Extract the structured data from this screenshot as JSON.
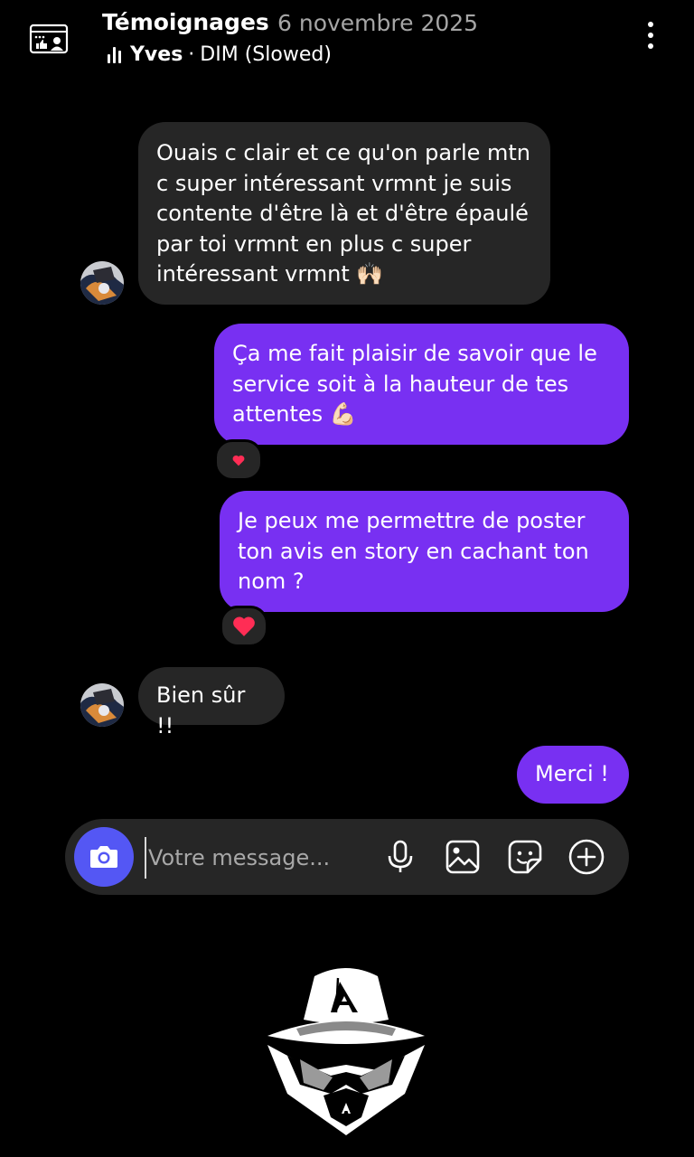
{
  "header": {
    "title": "Témoignages",
    "date": "6 novembre 2025",
    "music_artist": "Yves",
    "music_separator": "·",
    "music_track": "DIM (Slowed)",
    "icons": [
      "reviews-icon",
      "music-bars-icon",
      "more-options-icon"
    ]
  },
  "messages": [
    {
      "from": "them",
      "text": "Ouais c clair et ce qu'on parle mtn c super intéressant vrmnt je suis contente d'être là et d'être épaulé par toi vrmnt en plus c super intéressant vrmnt 🙌🏻"
    },
    {
      "from": "me",
      "text": "Ça me fait plaisir de savoir que le service soit à la hauteur de tes attentes 💪🏻",
      "reaction": "❤️"
    },
    {
      "from": "me",
      "text": "Je peux me permettre de poster ton avis en story en cachant ton nom ?",
      "reaction": "❤️"
    },
    {
      "from": "them",
      "text": "Bien sûr !!"
    },
    {
      "from": "me",
      "text": "Merci !"
    }
  ],
  "composer": {
    "placeholder": "Votre message...",
    "icons": [
      "camera-icon",
      "microphone-icon",
      "gallery-icon",
      "sticker-icon",
      "add-icon"
    ]
  },
  "colors": {
    "background": "#000000",
    "incoming_bubble": "#262626",
    "outgoing_bubble": "#7830f2",
    "camera_button": "#5457f4",
    "reaction_heart": "#ff2d55"
  },
  "watermark": {
    "logo_letter": "A"
  }
}
